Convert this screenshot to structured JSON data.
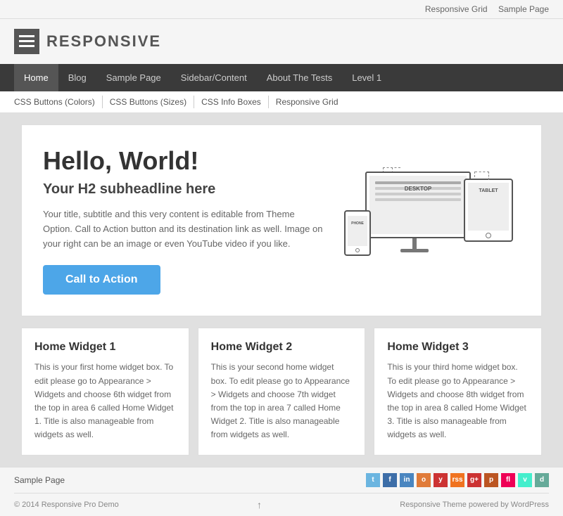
{
  "topbar": {
    "links": [
      "Responsive Grid",
      "Sample Page"
    ]
  },
  "header": {
    "logo_text": "RESPONSIVE"
  },
  "main_nav": {
    "items": [
      "Home",
      "Blog",
      "Sample Page",
      "Sidebar/Content",
      "About The Tests",
      "Level 1"
    ]
  },
  "sub_nav": {
    "items": [
      "CSS Buttons (Colors)",
      "CSS Buttons (Sizes)",
      "CSS Info Boxes",
      "Responsive Grid"
    ]
  },
  "hero": {
    "title": "Hello, World!",
    "subtitle": "Your H2 subheadline here",
    "body": "Your title, subtitle and this very content is editable from Theme Option. Call to Action button and its destination link as well. Image on your right can be an image or even YouTube video if you like.",
    "cta_label": "Call to Action",
    "device_labels": {
      "desktop": "DESKTOP",
      "tablet": "TABLET",
      "phone": "PHONE"
    }
  },
  "widgets": [
    {
      "title": "Home Widget 1",
      "body": "This is your first home widget box. To edit please go to Appearance > Widgets and choose 6th widget from the top in area 6 called Home Widget 1. Title is also manageable from widgets as well."
    },
    {
      "title": "Home Widget 2",
      "body": "This is your second home widget box. To edit please go to Appearance > Widgets and choose 7th widget from the top in area 7 called Home Widget 2. Title is also manageable from widgets as well."
    },
    {
      "title": "Home Widget 3",
      "body": "This is your third home widget box. To edit please go to Appearance > Widgets and choose 8th widget from the top in area 8 called Home Widget 3. Title is also manageable from widgets as well."
    }
  ],
  "footer": {
    "link": "Sample Page",
    "social_icons": [
      "t",
      "f",
      "in",
      "o",
      "y",
      "rss",
      "g+",
      "p",
      "fl",
      "v",
      "d"
    ],
    "copyright": "© 2014 Responsive Pro Demo",
    "theme_credit": "Responsive Theme powered by WordPress",
    "arrow": "↑"
  }
}
